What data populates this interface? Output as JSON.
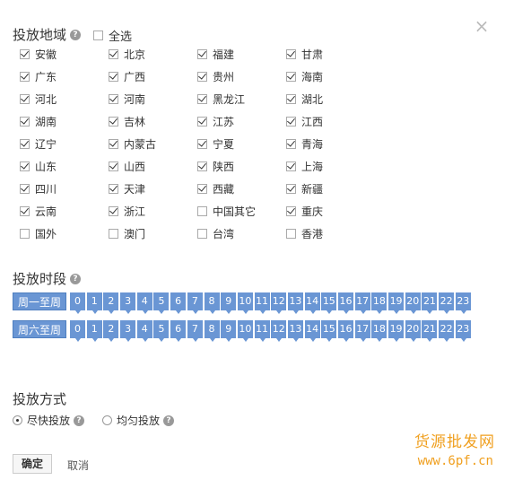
{
  "close_label": "×",
  "region": {
    "title": "投放地域",
    "help": "?",
    "select_all": "全选",
    "items": [
      {
        "label": "安徽",
        "checked": true
      },
      {
        "label": "北京",
        "checked": true
      },
      {
        "label": "福建",
        "checked": true
      },
      {
        "label": "甘肃",
        "checked": true
      },
      {
        "label": "广东",
        "checked": true
      },
      {
        "label": "广西",
        "checked": true
      },
      {
        "label": "贵州",
        "checked": true
      },
      {
        "label": "海南",
        "checked": true
      },
      {
        "label": "河北",
        "checked": true
      },
      {
        "label": "河南",
        "checked": true
      },
      {
        "label": "黑龙江",
        "checked": true
      },
      {
        "label": "湖北",
        "checked": true
      },
      {
        "label": "湖南",
        "checked": true
      },
      {
        "label": "吉林",
        "checked": true
      },
      {
        "label": "江苏",
        "checked": true
      },
      {
        "label": "江西",
        "checked": true
      },
      {
        "label": "辽宁",
        "checked": true
      },
      {
        "label": "内蒙古",
        "checked": true
      },
      {
        "label": "宁夏",
        "checked": true
      },
      {
        "label": "青海",
        "checked": true
      },
      {
        "label": "山东",
        "checked": true
      },
      {
        "label": "山西",
        "checked": true
      },
      {
        "label": "陕西",
        "checked": true
      },
      {
        "label": "上海",
        "checked": true
      },
      {
        "label": "四川",
        "checked": true
      },
      {
        "label": "天津",
        "checked": true
      },
      {
        "label": "西藏",
        "checked": true
      },
      {
        "label": "新疆",
        "checked": true
      },
      {
        "label": "云南",
        "checked": true
      },
      {
        "label": "浙江",
        "checked": true
      },
      {
        "label": "中国其它",
        "checked": false
      },
      {
        "label": "重庆",
        "checked": true
      },
      {
        "label": "国外",
        "checked": false
      },
      {
        "label": "澳门",
        "checked": false
      },
      {
        "label": "台湾",
        "checked": false
      },
      {
        "label": "香港",
        "checked": false
      }
    ]
  },
  "time": {
    "title": "投放时段",
    "help": "?",
    "rows": [
      {
        "label": "周一至周",
        "hours": [
          "0",
          "1",
          "2",
          "3",
          "4",
          "5",
          "6",
          "7",
          "8",
          "9",
          "10",
          "11",
          "12",
          "13",
          "14",
          "15",
          "16",
          "17",
          "18",
          "19",
          "20",
          "21",
          "22",
          "23"
        ]
      },
      {
        "label": "周六至周",
        "hours": [
          "0",
          "1",
          "2",
          "3",
          "4",
          "5",
          "6",
          "7",
          "8",
          "9",
          "10",
          "11",
          "12",
          "13",
          "14",
          "15",
          "16",
          "17",
          "18",
          "19",
          "20",
          "21",
          "22",
          "23"
        ]
      }
    ],
    "accent": "#6a96d4"
  },
  "delivery": {
    "title": "投放方式",
    "options": [
      {
        "label": "尽快投放",
        "selected": true
      },
      {
        "label": "均匀投放",
        "selected": false
      }
    ],
    "help": "?"
  },
  "actions": {
    "ok": "确定",
    "cancel": "取消"
  },
  "watermark": {
    "logo": "货源批发网",
    "url": "www.6pf.cn",
    "color": "#f0a020"
  }
}
